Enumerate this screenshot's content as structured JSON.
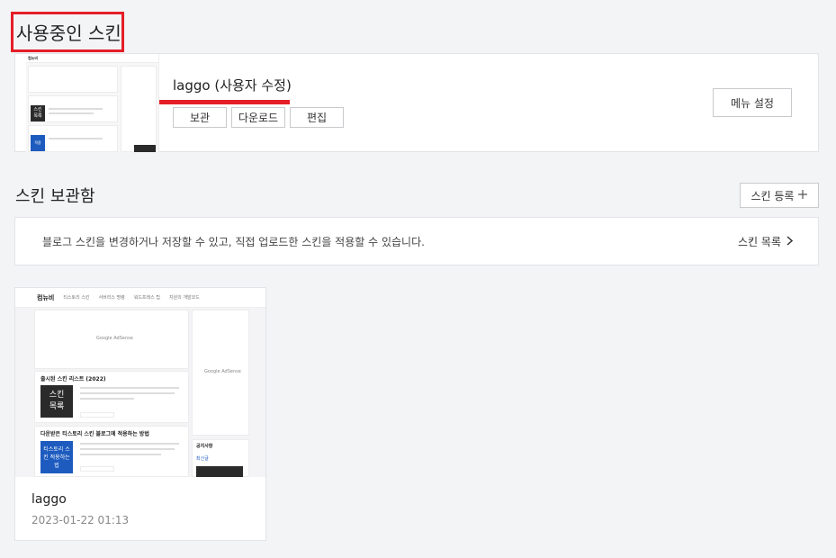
{
  "current_section": {
    "title": "사용중인 스킨",
    "skin_name": "laggo (사용자 수정)",
    "buttons": [
      "보관",
      "다운로드",
      "편집"
    ],
    "menu_button": "메뉴 설정"
  },
  "storage_section": {
    "title": "스킨 보관함",
    "register_button": "스킨 등록",
    "register_icon": "plus-icon",
    "info_text": "블로그 스킨을 변경하거나 저장할 수 있고, 직접 업로드한 스킨을 적용할 수 있습니다.",
    "skin_list_link": "스킨 목록",
    "skin_list_icon": "chevron-right-icon"
  },
  "skin_card": {
    "name": "laggo",
    "date": "2023-01-22 01:13"
  },
  "thumbnail": {
    "logo": "컴뉴비",
    "nav": [
      "티스토리 스킨",
      "서버리스 명령",
      "워드프레스 팁",
      "지원의 개발코드"
    ],
    "ad_text": "Google AdSense",
    "post1_title": "출시된 스킨 리스트 (2022)",
    "post1_badge": "스킨 목록",
    "post2_title": "다운받은 티스토리 스킨 블로그에 적용하는 방법",
    "post2_badge": "티스토리 스킨 적용하는 법",
    "side_heading": "공지사항",
    "side_label": "최신글"
  },
  "colors": {
    "highlight_red": "#e41e26",
    "border": "#c9cacd",
    "page_bg": "#f3f4f6"
  }
}
